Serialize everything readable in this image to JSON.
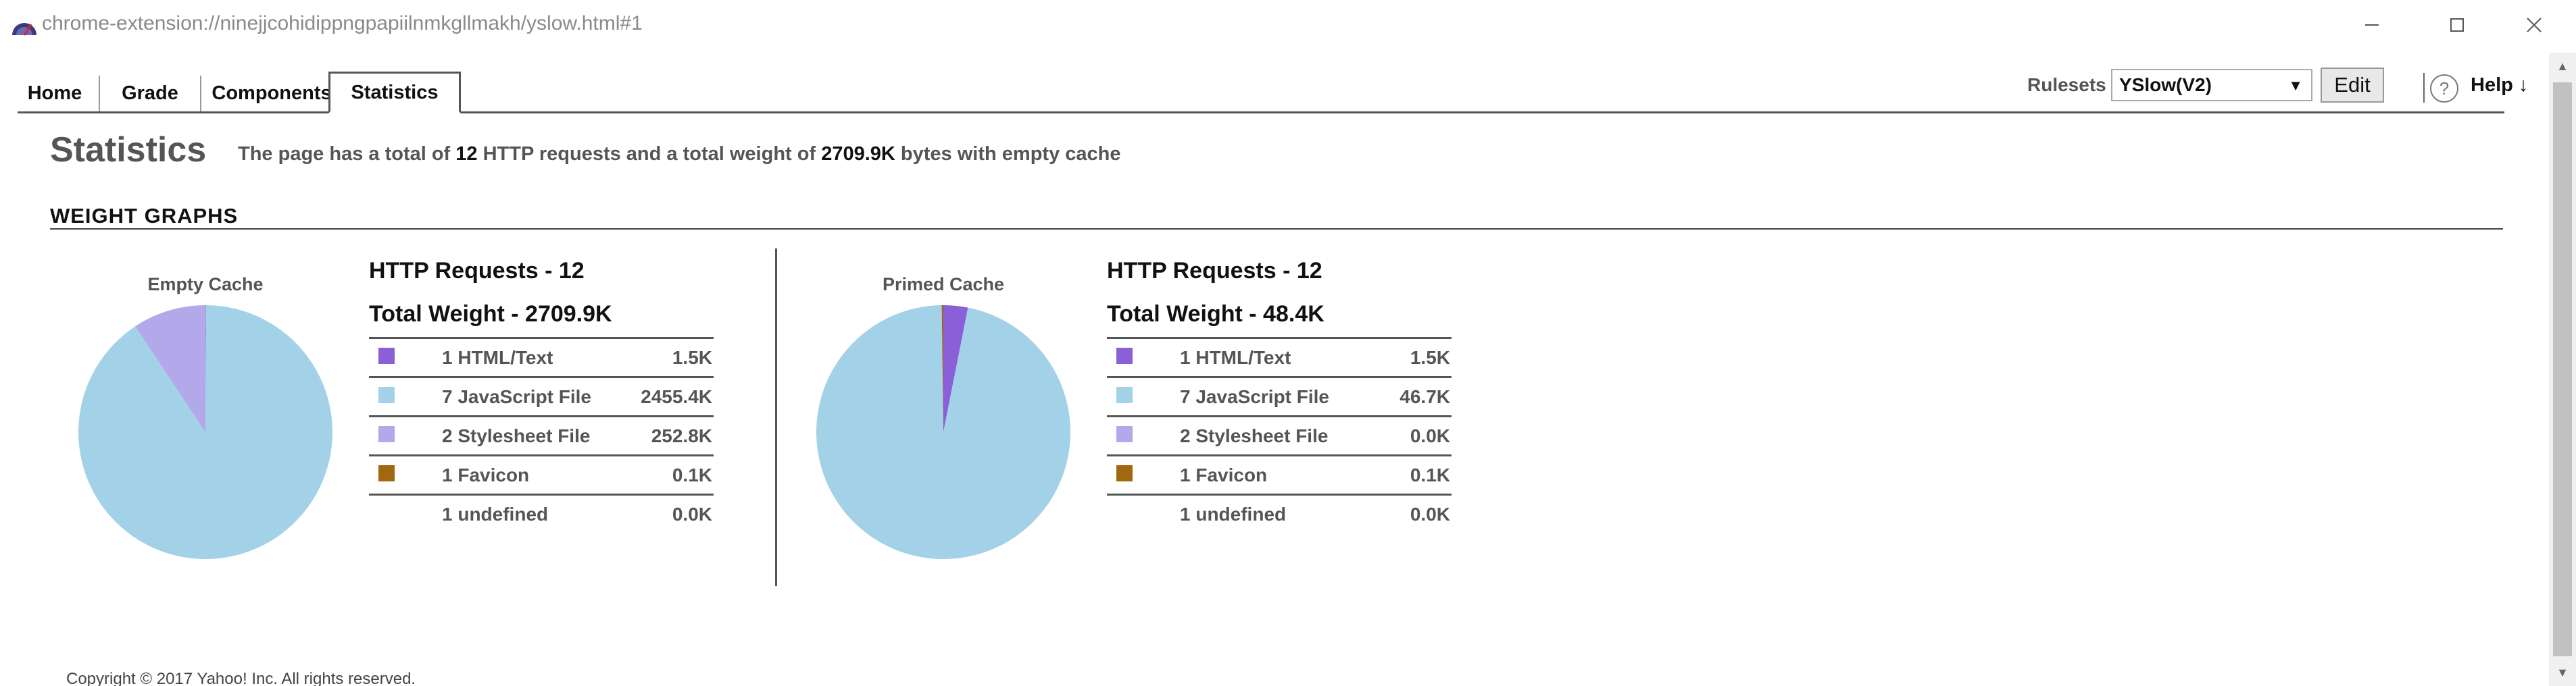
{
  "window": {
    "title": "chrome-extension://ninejjcohidippngpapiilnmkgllmakh/yslow.html#1"
  },
  "tabs": [
    {
      "label": "Home"
    },
    {
      "label": "Grade"
    },
    {
      "label": "Components"
    },
    {
      "label": "Statistics",
      "active": true
    }
  ],
  "toolbar": {
    "rulesets_label": "Rulesets",
    "rulesets_value": "YSlow(V2)",
    "edit_label": "Edit",
    "help_label": "Help ↓",
    "help_icon": "?"
  },
  "page": {
    "title": "Statistics",
    "summary_prefix": "The page has a total of",
    "requests": "12",
    "summary_mid": "HTTP requests and a total weight of",
    "weight": "2709.9K",
    "summary_suffix": "bytes with empty cache",
    "section_title": "WEIGHT GRAPHS"
  },
  "colors": {
    "html": "#8a5fd8",
    "javascript": "#a3d2e8",
    "stylesheet": "#b3a8ea",
    "favicon": "#a0690f"
  },
  "panels": [
    {
      "caption": "Empty Cache",
      "requests_heading": "HTTP Requests - 12",
      "weight_heading": "Total Weight - 2709.9K",
      "rows": [
        {
          "count_label": "1 HTML/Text",
          "value": "1.5K",
          "color": "#8a5fd8"
        },
        {
          "count_label": "7 JavaScript File",
          "value": "2455.4K",
          "color": "#a3d2e8"
        },
        {
          "count_label": "2 Stylesheet File",
          "value": "252.8K",
          "color": "#b3a8ea"
        },
        {
          "count_label": "1 Favicon",
          "value": "0.1K",
          "color": "#a0690f"
        },
        {
          "count_label": "1 undefined",
          "value": "0.0K",
          "color": ""
        }
      ],
      "pie": [
        {
          "name": "HTML/Text",
          "value": 1.5,
          "color": "#8a5fd8"
        },
        {
          "name": "JavaScript File",
          "value": 2455.4,
          "color": "#a3d2e8"
        },
        {
          "name": "Stylesheet File",
          "value": 252.8,
          "color": "#b3a8ea"
        },
        {
          "name": "Favicon",
          "value": 0.1,
          "color": "#a0690f"
        }
      ]
    },
    {
      "caption": "Primed Cache",
      "requests_heading": "HTTP Requests - 12",
      "weight_heading": "Total Weight - 48.4K",
      "rows": [
        {
          "count_label": "1 HTML/Text",
          "value": "1.5K",
          "color": "#8a5fd8"
        },
        {
          "count_label": "7 JavaScript File",
          "value": "46.7K",
          "color": "#a3d2e8"
        },
        {
          "count_label": "2 Stylesheet File",
          "value": "0.0K",
          "color": "#b3a8ea"
        },
        {
          "count_label": "1 Favicon",
          "value": "0.1K",
          "color": "#a0690f"
        },
        {
          "count_label": "1 undefined",
          "value": "0.0K",
          "color": ""
        }
      ],
      "pie": [
        {
          "name": "HTML/Text",
          "value": 1.5,
          "color": "#8a5fd8"
        },
        {
          "name": "JavaScript File",
          "value": 46.7,
          "color": "#a3d2e8"
        },
        {
          "name": "Stylesheet File",
          "value": 0.0,
          "color": "#b3a8ea"
        },
        {
          "name": "Favicon",
          "value": 0.1,
          "color": "#a0690f"
        }
      ]
    }
  ],
  "footer": {
    "text": "Copyright © 2017 Yahoo! Inc. All rights reserved."
  }
}
